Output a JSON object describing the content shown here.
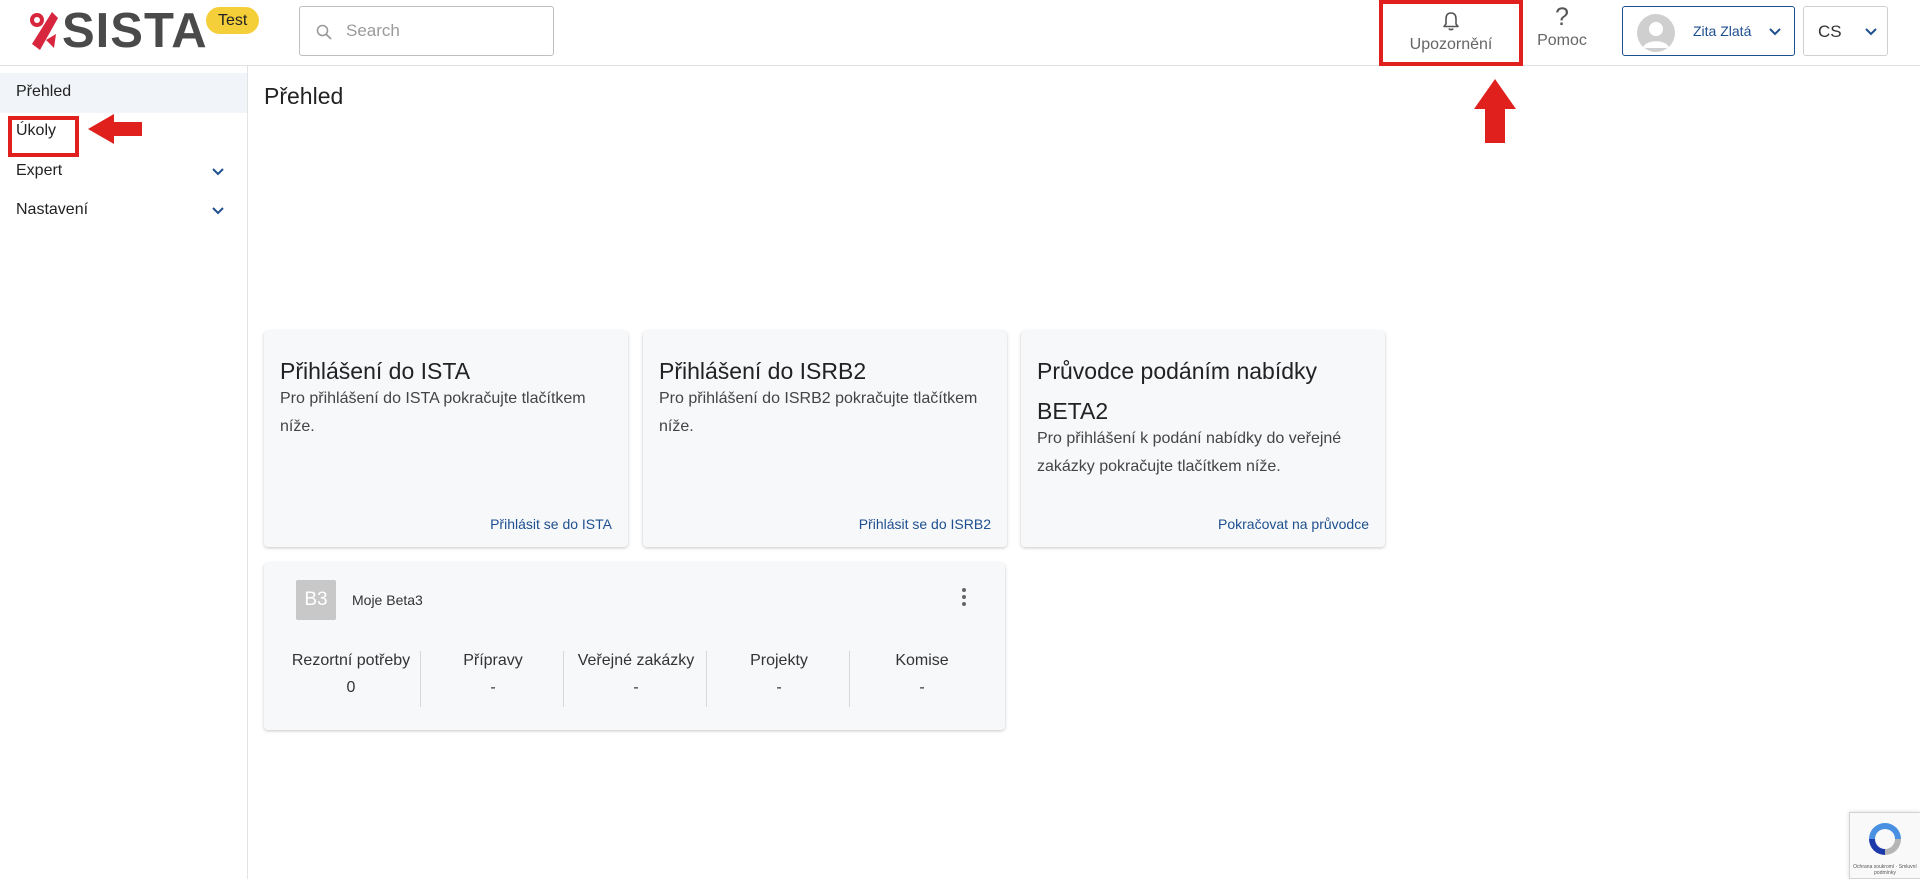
{
  "header": {
    "logo_text": "SISTA",
    "env_badge": "Test",
    "search_placeholder": "Search",
    "notifications_label": "Upozornění",
    "help_label": "Pomoc",
    "help_glyph": "?",
    "user_name": "Zita Zlatá",
    "language": "CS"
  },
  "sidebar": {
    "items": [
      {
        "label": "Přehled",
        "active": true
      },
      {
        "label": "Úkoly"
      },
      {
        "label": "Expert",
        "expandable": true
      },
      {
        "label": "Nastavení",
        "expandable": true
      }
    ]
  },
  "main": {
    "title": "Přehled",
    "cards": [
      {
        "title": "Přihlášení do ISTA",
        "description": "Pro přihlášení do ISTA pokračujte tlačítkem níže.",
        "link": "Přihlásit se do ISTA"
      },
      {
        "title": "Přihlášení do ISRB2",
        "description": "Pro přihlášení do ISRB2 pokračujte tlačítkem níže.",
        "link": "Přihlásit se do ISRB2"
      },
      {
        "title": "Průvodce podáním nabídky BETA2",
        "description": "Pro přihlášení k podání nabídky do veřejné zakázky pokračujte tlačítkem níže.",
        "link": "Pokračovat na průvodce"
      }
    ],
    "beta": {
      "badge": "B3",
      "name": "Moje Beta3",
      "stats": [
        {
          "label": "Rezortní potřeby",
          "value": "0"
        },
        {
          "label": "Přípravy",
          "value": "-"
        },
        {
          "label": "Veřejné zakázky",
          "value": "-"
        },
        {
          "label": "Projekty",
          "value": "-"
        },
        {
          "label": "Komise",
          "value": "-"
        }
      ]
    }
  },
  "captcha": {
    "text": "Ochrana soukromí · Smluvní podmínky"
  },
  "colors": {
    "accent": "#1e4f8f",
    "badge": "#f5cf3a",
    "annotation": "#e0201c",
    "logo_red": "#d7263d"
  }
}
